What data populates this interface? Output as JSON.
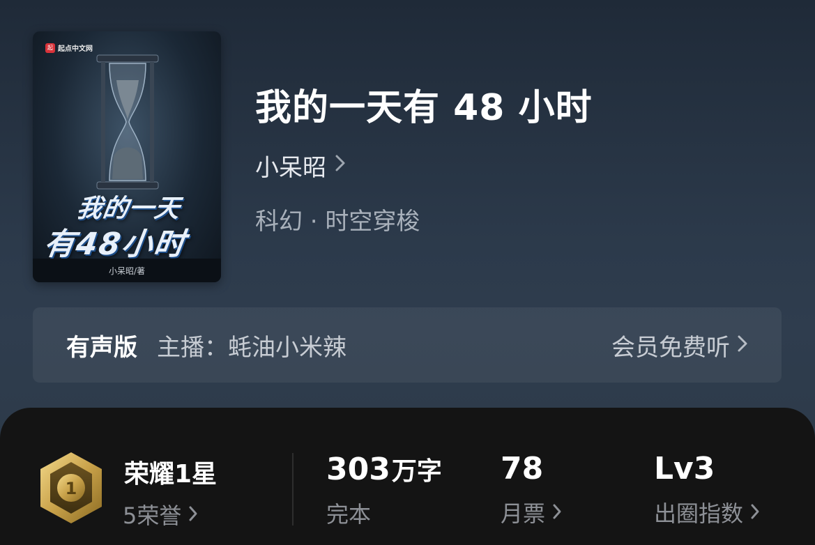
{
  "book": {
    "title": "我的一天有 48 小时",
    "author": "小呆昭",
    "genre": "科幻 · 时空穿梭"
  },
  "cover": {
    "publisher": "起点中文网",
    "title_line1": "我的一天",
    "title_line2": "有48小时",
    "author_credit": "小呆昭/著"
  },
  "audio": {
    "label": "有声版",
    "host": "主播：蚝油小米辣",
    "action": "会员免费听"
  },
  "stats": {
    "honor_title": "荣耀1星",
    "honor_sub": "5荣誉",
    "words_value": "303",
    "words_unit": "万字",
    "words_label": "完本",
    "tickets_value": "78",
    "tickets_label": "月票",
    "index_value": "Lv3",
    "index_label": "出圈指数"
  },
  "badge": {
    "number": "1"
  },
  "icons": {
    "chevron": "chevron-right-icon",
    "badge": "honor-badge-icon"
  },
  "colors": {
    "gold": "#c9a24a",
    "panel": "#141414"
  }
}
